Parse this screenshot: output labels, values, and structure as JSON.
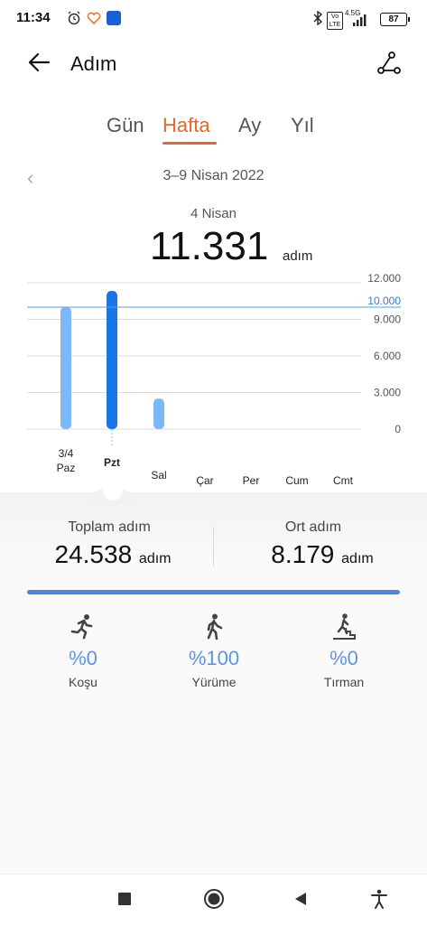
{
  "status_bar": {
    "time": "11:34",
    "network": "4.5G",
    "volte": "Vo LTE",
    "battery": "87",
    "icons": [
      "alarm-icon",
      "health-icon",
      "app-badge-icon",
      "bluetooth-icon",
      "signal-icon"
    ]
  },
  "header": {
    "title": "Adım"
  },
  "tabs": [
    {
      "label": "Gün"
    },
    {
      "label": "Hafta",
      "active": true
    },
    {
      "label": "Ay"
    },
    {
      "label": "Yıl"
    }
  ],
  "range_label": "3–9 Nisan 2022",
  "selected": {
    "date": "4 Nisan",
    "value": "11.331",
    "unit": "adım"
  },
  "chart_data": {
    "type": "bar",
    "categories": [
      "Paz",
      "Pzt",
      "Sal",
      "Çar",
      "Per",
      "Cum",
      "Cmt"
    ],
    "category_dates": [
      "3/4",
      "",
      "",
      "",
      "",
      "",
      ""
    ],
    "values": [
      10026,
      11331,
      2510,
      0,
      0,
      0,
      0
    ],
    "selected_index": 1,
    "yticks": [
      "12.000",
      "9.000",
      "6.000",
      "3.000",
      "0"
    ],
    "ytick_values": [
      12000,
      9000,
      6000,
      3000,
      0
    ],
    "goal": 10000,
    "goal_label": "10.000",
    "ylim": [
      0,
      12000
    ],
    "colors": {
      "bar": "#7bb8f7",
      "selected": "#1976e6",
      "goal": "#5aa0d8"
    }
  },
  "summary": {
    "total_label": "Toplam adım",
    "total_value": "24.538",
    "total_unit": "adım",
    "avg_label": "Ort adım",
    "avg_value": "8.179",
    "avg_unit": "adım"
  },
  "activities": [
    {
      "icon": "running-icon",
      "pct": "%0",
      "label": "Koşu"
    },
    {
      "icon": "walking-icon",
      "pct": "%100",
      "label": "Yürüme"
    },
    {
      "icon": "climbing-icon",
      "pct": "%0",
      "label": "Tırman"
    }
  ],
  "activity_progress": 1.0
}
